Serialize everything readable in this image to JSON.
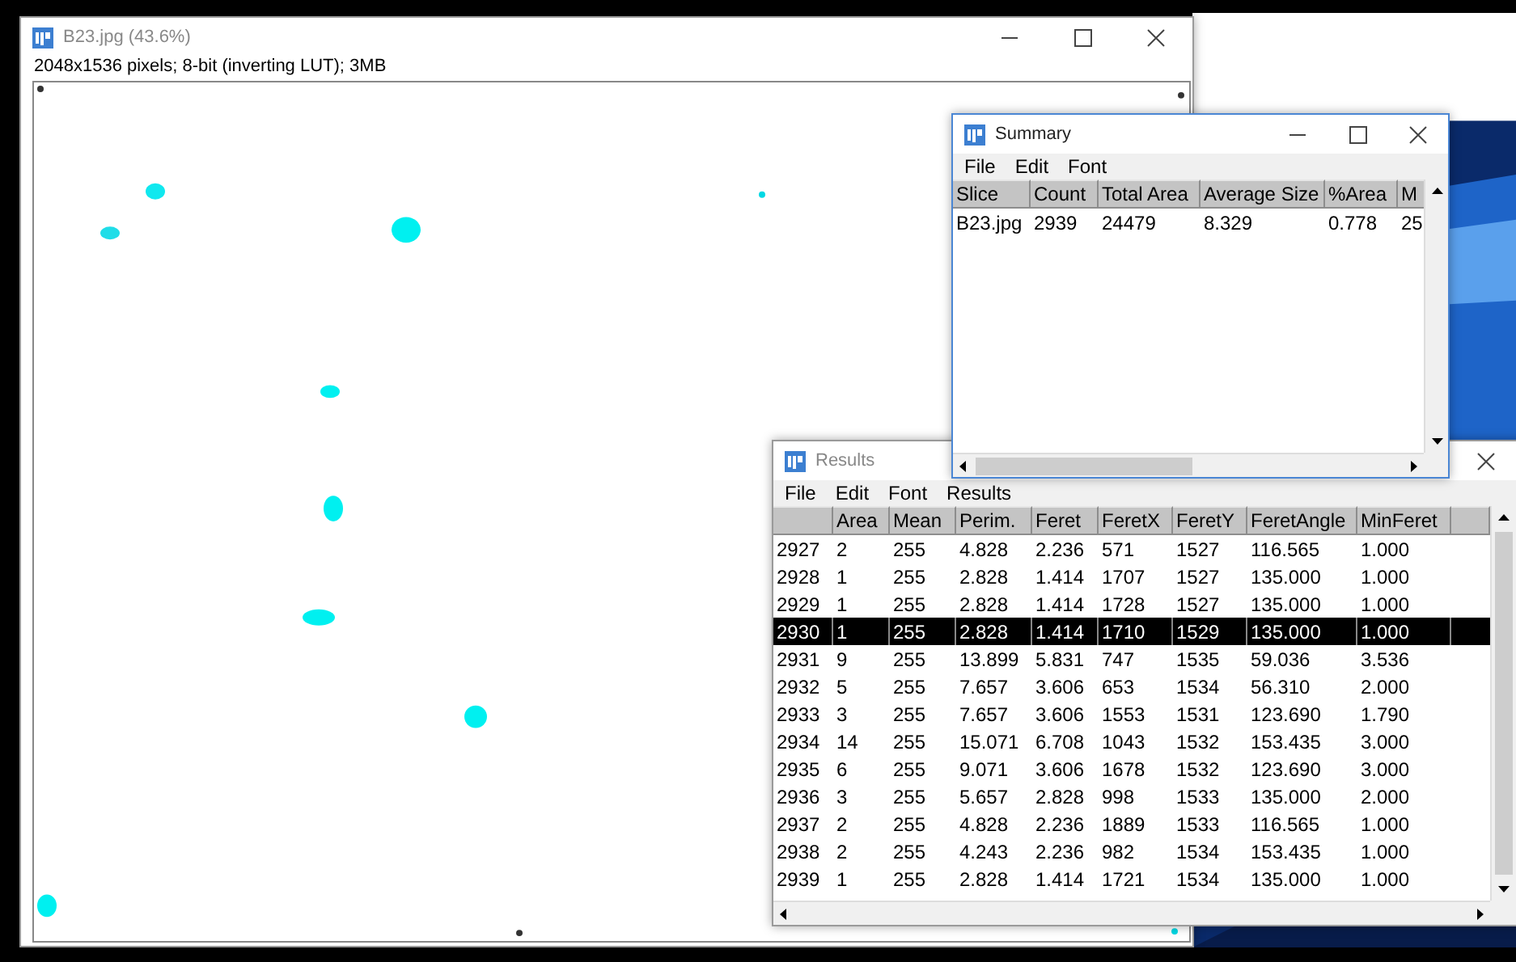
{
  "image_window": {
    "title": "B23.jpg (43.6%)",
    "info": "2048x1536 pixels; 8-bit (inverting LUT); 3MB"
  },
  "results_window": {
    "title": "Results",
    "menu": [
      "File",
      "Edit",
      "Font",
      "Results"
    ],
    "columns": [
      "",
      "Area",
      "Mean",
      "Perim.",
      "Feret",
      "FeretX",
      "FeretY",
      "FeretAngle",
      "MinFeret"
    ],
    "rows": [
      {
        "cells": [
          "2927",
          "2",
          "255",
          "4.828",
          "2.236",
          "571",
          "1527",
          "116.565",
          "1.000"
        ],
        "selected": false
      },
      {
        "cells": [
          "2928",
          "1",
          "255",
          "2.828",
          "1.414",
          "1707",
          "1527",
          "135.000",
          "1.000"
        ],
        "selected": false
      },
      {
        "cells": [
          "2929",
          "1",
          "255",
          "2.828",
          "1.414",
          "1728",
          "1527",
          "135.000",
          "1.000"
        ],
        "selected": false
      },
      {
        "cells": [
          "2930",
          "1",
          "255",
          "2.828",
          "1.414",
          "1710",
          "1529",
          "135.000",
          "1.000"
        ],
        "selected": true
      },
      {
        "cells": [
          "2931",
          "9",
          "255",
          "13.899",
          "5.831",
          "747",
          "1535",
          "59.036",
          "3.536"
        ],
        "selected": false
      },
      {
        "cells": [
          "2932",
          "5",
          "255",
          "7.657",
          "3.606",
          "653",
          "1534",
          "56.310",
          "2.000"
        ],
        "selected": false
      },
      {
        "cells": [
          "2933",
          "3",
          "255",
          "7.657",
          "3.606",
          "1553",
          "1531",
          "123.690",
          "1.790"
        ],
        "selected": false
      },
      {
        "cells": [
          "2934",
          "14",
          "255",
          "15.071",
          "6.708",
          "1043",
          "1532",
          "153.435",
          "3.000"
        ],
        "selected": false
      },
      {
        "cells": [
          "2935",
          "6",
          "255",
          "9.071",
          "3.606",
          "1678",
          "1532",
          "123.690",
          "3.000"
        ],
        "selected": false
      },
      {
        "cells": [
          "2936",
          "3",
          "255",
          "5.657",
          "2.828",
          "998",
          "1533",
          "135.000",
          "2.000"
        ],
        "selected": false
      },
      {
        "cells": [
          "2937",
          "2",
          "255",
          "4.828",
          "2.236",
          "1889",
          "1533",
          "116.565",
          "1.000"
        ],
        "selected": false
      },
      {
        "cells": [
          "2938",
          "2",
          "255",
          "4.243",
          "2.236",
          "982",
          "1534",
          "153.435",
          "1.000"
        ],
        "selected": false
      },
      {
        "cells": [
          "2939",
          "1",
          "255",
          "2.828",
          "1.414",
          "1721",
          "1534",
          "135.000",
          "1.000"
        ],
        "selected": false
      }
    ]
  },
  "summary_window": {
    "title": "Summary",
    "menu": [
      "File",
      "Edit",
      "Font"
    ],
    "columns": [
      "Slice",
      "Count",
      "Total Area",
      "Average Size",
      "%Area",
      "M"
    ],
    "rows": [
      {
        "cells": [
          "B23.jpg",
          "2939",
          "24479",
          "8.329",
          "0.778",
          "25"
        ],
        "selected": false
      }
    ]
  }
}
